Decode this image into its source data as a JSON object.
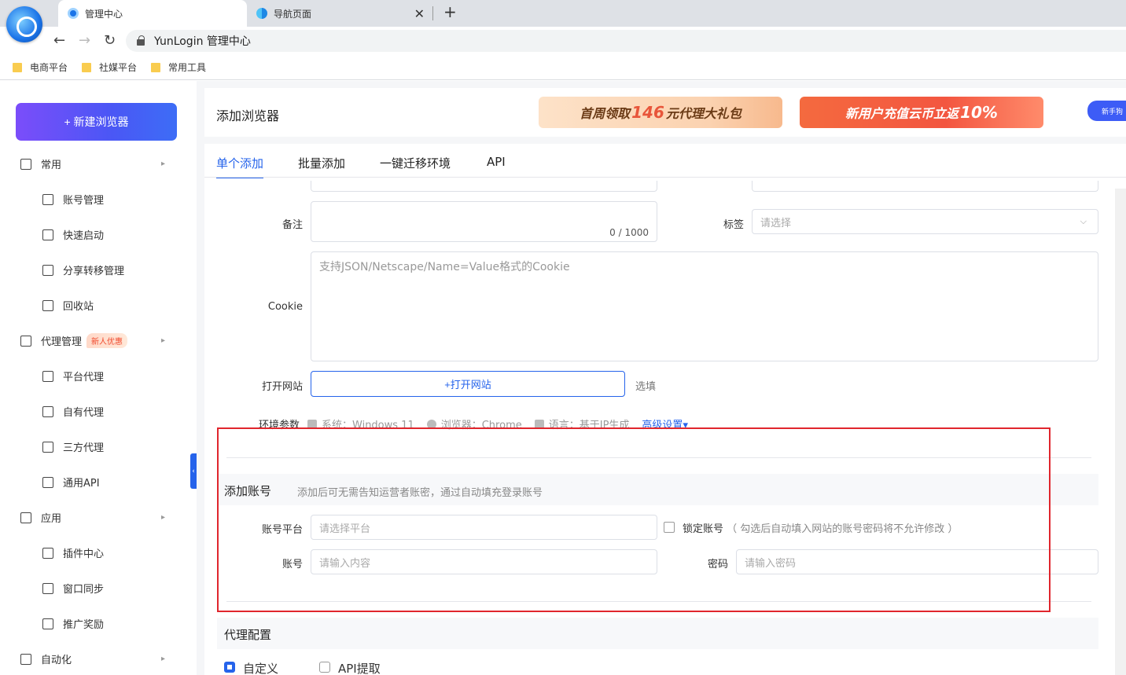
{
  "browser": {
    "tabs": [
      {
        "title": "管理中心"
      },
      {
        "title": "导航页面"
      }
    ],
    "address": "YunLogin 管理中心",
    "bookmarks": [
      "电商平台",
      "社媒平台",
      "常用工具"
    ]
  },
  "sidebar": {
    "new_button": "+ 新建浏览器",
    "items": [
      {
        "label": "常用",
        "icon": "home-icon",
        "level": "top"
      },
      {
        "label": "账号管理",
        "icon": "user-list-icon",
        "level": "sub"
      },
      {
        "label": "快速启动",
        "icon": "rocket-icon",
        "level": "sub"
      },
      {
        "label": "分享转移管理",
        "icon": "transfer-icon",
        "level": "sub"
      },
      {
        "label": "回收站",
        "icon": "trash-icon",
        "level": "sub"
      },
      {
        "label": "代理管理",
        "icon": "proxy-user-icon",
        "level": "top",
        "badge": "新人优惠"
      },
      {
        "label": "平台代理",
        "icon": "platform-icon",
        "level": "sub"
      },
      {
        "label": "自有代理",
        "icon": "user-list-icon",
        "level": "sub"
      },
      {
        "label": "三方代理",
        "icon": "users-icon",
        "level": "sub"
      },
      {
        "label": "通用API",
        "icon": "api-icon",
        "level": "sub"
      },
      {
        "label": "应用",
        "icon": "apps-icon",
        "level": "top"
      },
      {
        "label": "插件中心",
        "icon": "plugin-icon",
        "level": "sub"
      },
      {
        "label": "窗口同步",
        "icon": "sync-icon",
        "level": "sub"
      },
      {
        "label": "推广奖励",
        "icon": "megaphone-icon",
        "level": "sub"
      },
      {
        "label": "自动化",
        "icon": "robot-icon",
        "level": "top"
      }
    ]
  },
  "header": {
    "title": "添加浏览器",
    "promo1": {
      "pre": "首周领取",
      "num": "146",
      "post": "元代理大礼包"
    },
    "promo2": {
      "pre": "新用户充值云币立返",
      "num": "10%"
    },
    "promo3": "新手狗"
  },
  "tabs": [
    "单个添加",
    "批量添加",
    "一键迁移环境",
    "API"
  ],
  "form": {
    "remark_label": "备注",
    "remark_count": "0 / 1000",
    "tag_label": "标签",
    "tag_placeholder": "请选择",
    "cookie_label": "Cookie",
    "cookie_placeholder": "支持JSON/Netscape/Name=Value格式的Cookie",
    "open_site_label": "打开网站",
    "open_site_button": "+打开网站",
    "optional_hint": "选填",
    "env_label": "环境参数",
    "env_os": "系统：Windows 11",
    "env_browser": "浏览器：Chrome",
    "env_lang": "语言：基于IP生成",
    "env_advanced": "高级设置"
  },
  "account_section": {
    "title": "添加账号",
    "desc": "添加后可无需告知运营者账密，通过自动填充登录账号",
    "platform_label": "账号平台",
    "platform_placeholder": "请选择平台",
    "lock_label": "锁定账号",
    "lock_hint": "（ 勾选后自动填入网站的账号密码将不允许修改 ）",
    "account_label": "账号",
    "account_placeholder": "请输入内容",
    "password_label": "密码",
    "password_placeholder": "请输入密码"
  },
  "proxy_section": {
    "title": "代理配置",
    "options": [
      "自定义",
      "API提取"
    ],
    "selected": "自定义"
  },
  "colors": {
    "accent": "#2563eb",
    "highlight": "#e0262d"
  }
}
